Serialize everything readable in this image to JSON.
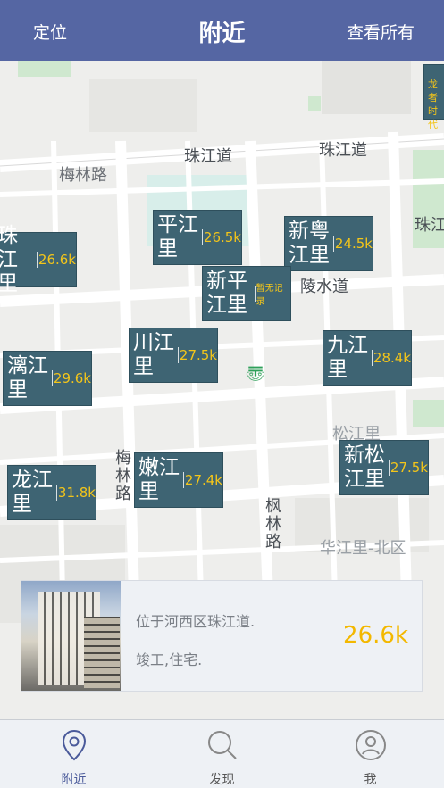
{
  "header": {
    "left_label": "定位",
    "title": "附近",
    "right_label": "查看所有"
  },
  "map": {
    "roads": [
      {
        "key": "zhujiang1",
        "text": "珠江道"
      },
      {
        "key": "zhujiang2",
        "text": "珠江道"
      },
      {
        "key": "meilin",
        "text": "梅林路"
      },
      {
        "key": "lingshui",
        "text": "陵水道"
      },
      {
        "key": "meilin_v",
        "text": "梅林路"
      },
      {
        "key": "fenglin_v",
        "text": "枫林路"
      },
      {
        "key": "huajiang_north",
        "text": "华江里-北区"
      },
      {
        "key": "songjiang",
        "text": "松江里"
      },
      {
        "key": "zhujiang_edge",
        "text": "珠江"
      }
    ],
    "markers": [
      {
        "name": "珠江里",
        "price": "26.6k"
      },
      {
        "name": "平江里",
        "price": "26.5k"
      },
      {
        "name": "新粤江里",
        "price": "24.5k"
      },
      {
        "name": "新平江里",
        "price": "暂无记录"
      },
      {
        "name": "川江里",
        "price": "27.5k"
      },
      {
        "name": "九江里",
        "price": "28.4k"
      },
      {
        "name": "漓江里",
        "price": "29.6k"
      },
      {
        "name": "嫩江里",
        "price": "27.4k"
      },
      {
        "name": "新松江里",
        "price": "27.5k"
      },
      {
        "name": "龙江里",
        "price": "31.8k"
      }
    ],
    "top_right_badge": "龙者时代"
  },
  "card": {
    "line1": "位于河西区珠江道.",
    "line2": "竣工,住宅.",
    "price": "26.6k"
  },
  "tabs": [
    {
      "label": "附近",
      "icon": "location-pin-icon",
      "active": true
    },
    {
      "label": "发现",
      "icon": "search-icon",
      "active": false
    },
    {
      "label": "我",
      "icon": "user-icon",
      "active": false
    }
  ],
  "colors": {
    "header_bg": "#5566a3",
    "marker_bg": "#3e6473",
    "price_yellow": "#f3c51a",
    "tab_active": "#4a5a9a"
  }
}
